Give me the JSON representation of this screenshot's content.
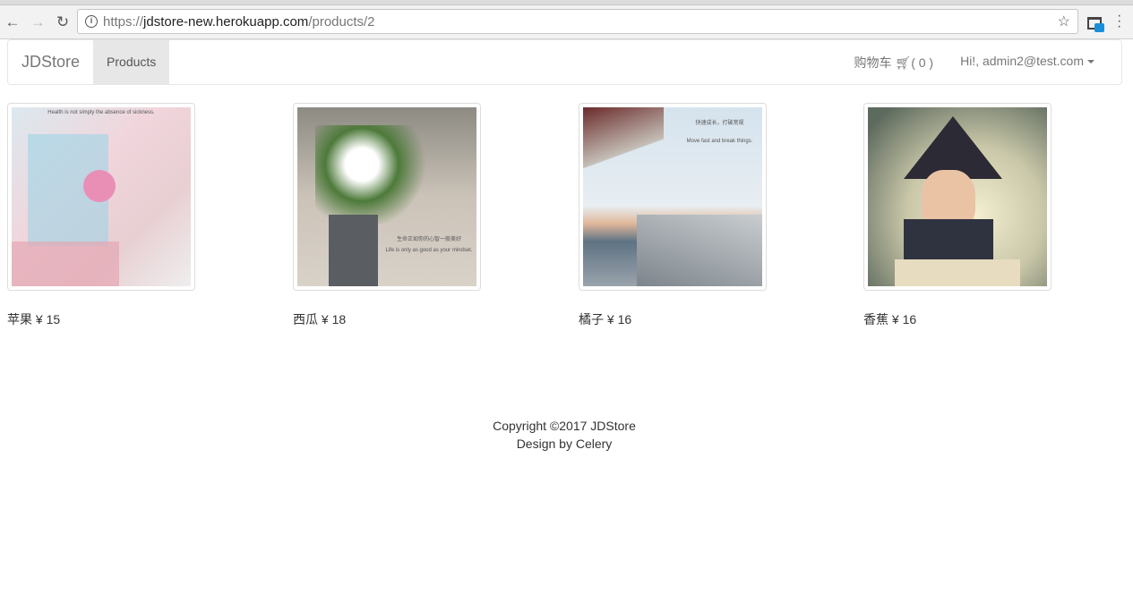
{
  "browser": {
    "url_scheme": "https://",
    "url_host": "jdstore-new.herokuapp.com",
    "url_path": "/products/2"
  },
  "navbar": {
    "brand": "JDStore",
    "products": "Products",
    "cart_label": "购物车",
    "cart_count": "( 0 )",
    "user": "Hi!, admin2@test.com"
  },
  "products": [
    {
      "name": "苹果",
      "price": "¥ 15",
      "image_text": [
        "Health is not simply the absence of sickness."
      ]
    },
    {
      "name": "西瓜",
      "price": "¥ 18",
      "image_text": [
        "生命正如你的心智一般美好",
        "Life is only as good as your mindset."
      ]
    },
    {
      "name": "橘子",
      "price": "¥ 16",
      "image_text": [
        "快速成长，打破常规",
        "Move fast and break things."
      ]
    },
    {
      "name": "香蕉",
      "price": "¥ 16",
      "image_text": []
    }
  ],
  "footer": {
    "copyright": "Copyright ©2017 JDStore",
    "design": "Design by Celery"
  }
}
